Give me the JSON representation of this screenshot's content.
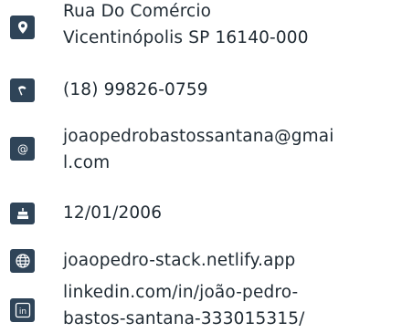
{
  "contact": {
    "address": {
      "line1": "Rua Do Comércio",
      "line2": "Vicentinópolis SP 16140-000",
      "icon": "location-pin-icon"
    },
    "phone": {
      "value": "(18) 99826-0759",
      "icon": "phone-icon"
    },
    "email": {
      "line1": "joaopedrobastossantana@gmai",
      "line2": "l.com",
      "icon": "at-sign-icon"
    },
    "birthdate": {
      "value": "12/01/2006",
      "icon": "cake-icon"
    },
    "website": {
      "value": "joaopedro-stack.netlify.app",
      "icon": "globe-icon"
    },
    "linkedin": {
      "line1": "linkedin.com/in/joão-pedro-",
      "line2": "bastos-santana-333015315/",
      "icon": "linkedin-icon"
    }
  },
  "colors": {
    "icon_background": "#2f4458",
    "icon_foreground": "#ffffff",
    "text": "#1f2a33"
  }
}
